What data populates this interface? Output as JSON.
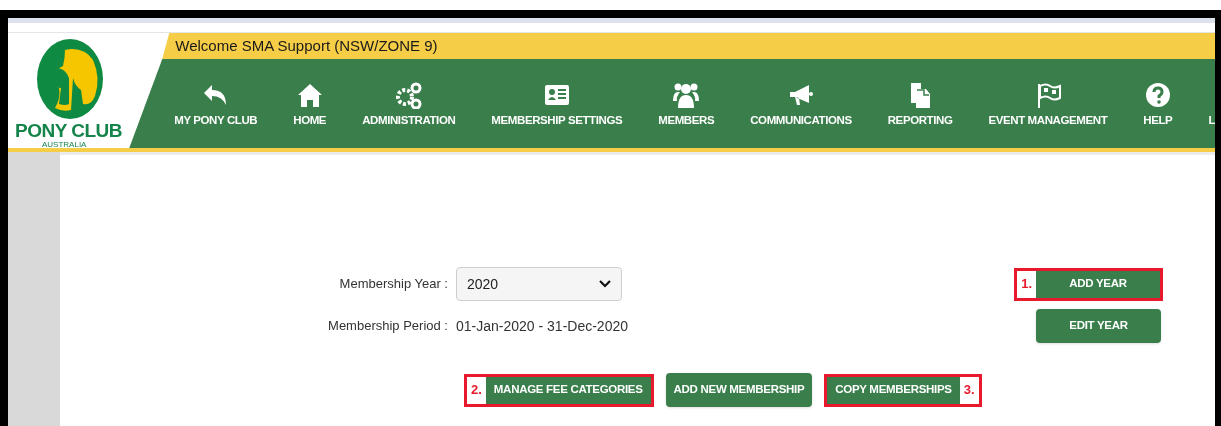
{
  "logo": {
    "name": "PONY CLUB",
    "subtitle": "AUSTRALIA"
  },
  "welcome": "Welcome SMA Support (NSW/ZONE 9)",
  "nav": [
    {
      "label": "MY PONY CLUB"
    },
    {
      "label": "HOME"
    },
    {
      "label": "ADMINISTRATION"
    },
    {
      "label": "MEMBERSHIP SETTINGS"
    },
    {
      "label": "MEMBERS"
    },
    {
      "label": "COMMUNICATIONS"
    },
    {
      "label": "REPORTING"
    },
    {
      "label": "EVENT MANAGEMENT"
    },
    {
      "label": "HELP"
    },
    {
      "label": "L"
    }
  ],
  "form": {
    "year_label": "Membership Year :",
    "year_value": "2020",
    "period_label": "Membership Period :",
    "period_value": "01-Jan-2020 - 31-Dec-2020"
  },
  "year_buttons": [
    {
      "label": "ADD YEAR",
      "annotation": "1.",
      "kind": "prefixed"
    },
    {
      "label": "EDIT YEAR",
      "kind": "plain"
    }
  ],
  "action_buttons": [
    {
      "label": "MANAGE FEE CATEGORIES",
      "annotation": "2.",
      "kind": "prefixed"
    },
    {
      "label": "ADD NEW MEMBERSHIP",
      "kind": "plain"
    },
    {
      "label": "COPY MEMBERSHIPS",
      "annotation": "3.",
      "kind": "suffixed"
    }
  ]
}
